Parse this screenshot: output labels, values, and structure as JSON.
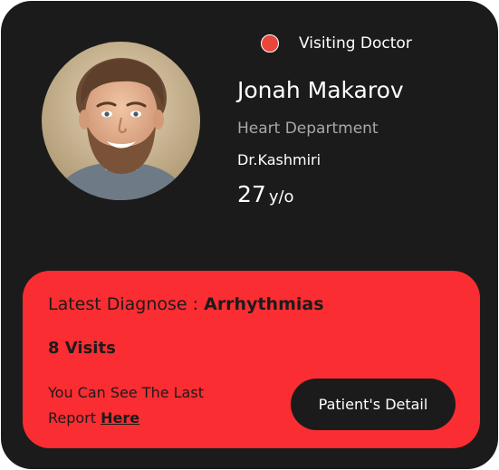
{
  "profile": {
    "status_label": "Visiting Doctor",
    "status_color": "#e8473a",
    "name": "Jonah Makarov",
    "department": "Heart Department",
    "doctor": "Dr.Kashmiri",
    "age": "27",
    "age_unit": "y/o"
  },
  "summary": {
    "diagnose_label": "Latest Diagnose : ",
    "diagnose_value": "Arrhythmias",
    "visits": "8 Visits",
    "report_text": "You Can See The Last Report ",
    "report_link": "Here",
    "detail_button": "Patient's Detail"
  },
  "colors": {
    "card_background": "#1c1b1b",
    "accent": "#fa2d32"
  }
}
